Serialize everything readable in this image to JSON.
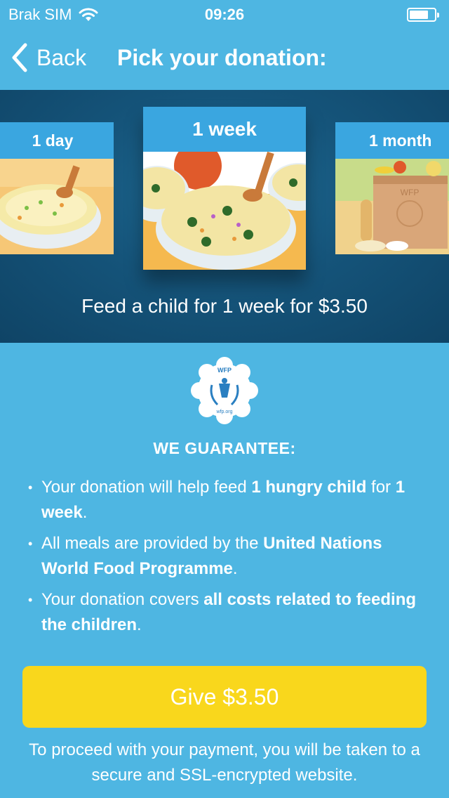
{
  "status_bar": {
    "carrier": "Brak SIM",
    "time": "09:26"
  },
  "nav": {
    "back_label": "Back",
    "title": "Pick your donation:"
  },
  "carousel": {
    "cards": [
      {
        "label": "1 day"
      },
      {
        "label": "1 week"
      },
      {
        "label": "1 month"
      }
    ],
    "caption": "Feed a child for 1 week for $3.50",
    "month_bag_label": "WFP"
  },
  "badge": {
    "top_text": "WFP",
    "bottom_text": "wfp.org"
  },
  "guarantee": {
    "title": "WE GUARANTEE:",
    "bullets": [
      {
        "p1": "Your donation will help feed ",
        "b1": "1 hungry child",
        "p2": " for ",
        "b2": "1 week",
        "p3": "."
      },
      {
        "p1": "All meals are provided by the ",
        "b1": "United Nations World Food Programme",
        "p2": "."
      },
      {
        "p1": "Your donation covers ",
        "b1": "all costs related to feeding the children",
        "p2": "."
      }
    ]
  },
  "give_button": {
    "label": "Give $3.50"
  },
  "footnote": "To proceed with your payment, you will be taken to a secure and SSL-encrypted website.",
  "colors": {
    "background": "#4eb6e2",
    "carousel": "#15547a",
    "card_header": "#3aa6e0",
    "button": "#f9d71c"
  }
}
